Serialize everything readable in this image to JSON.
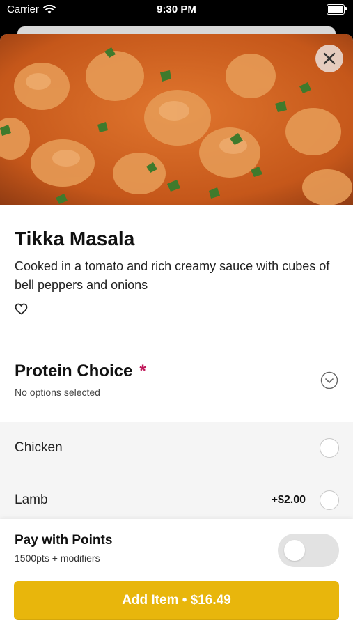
{
  "status_bar": {
    "carrier": "Carrier",
    "time": "9:30 PM"
  },
  "item": {
    "title": "Tikka Masala",
    "description": "Cooked in a tomato and rich creamy sauce with cubes of bell peppers and onions"
  },
  "protein_choice": {
    "title": "Protein Choice",
    "required_mark": "*",
    "subtitle": "No options selected",
    "options": [
      {
        "label": "Chicken",
        "price": ""
      },
      {
        "label": "Lamb",
        "price": "+$2.00"
      }
    ]
  },
  "pay_with_points": {
    "title": "Pay with Points",
    "subtitle": "1500pts + modifiers",
    "enabled": false
  },
  "add_button": {
    "label": "Add Item • $16.49"
  },
  "colors": {
    "accent": "#e8b60c",
    "required": "#c0185a"
  },
  "icons": [
    "wifi-icon",
    "battery-icon",
    "close-icon",
    "heart-icon",
    "chevron-down-circle-icon"
  ]
}
